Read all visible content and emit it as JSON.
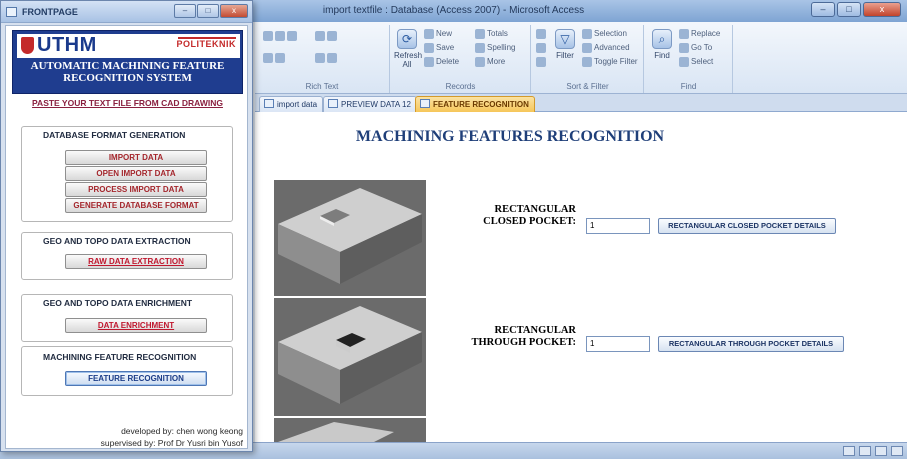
{
  "access_window": {
    "title": "import textfile : Database (Access 2007) - Microsoft Access",
    "window_buttons": [
      "–",
      "□",
      "x"
    ],
    "ribbon": {
      "groups": [
        {
          "label": "Rich Text"
        },
        {
          "label": "Records"
        },
        {
          "label": "Sort & Filter"
        },
        {
          "label": "Find"
        }
      ],
      "refresh_label": "Refresh All",
      "records_items": {
        "new": "New",
        "save": "Save",
        "delete": "Delete",
        "totals": "Totals",
        "spelling": "Spelling",
        "more": "More"
      },
      "filter_items": {
        "filter": "Filter",
        "selection": "Selection",
        "advanced": "Advanced",
        "toggle": "Toggle Filter"
      },
      "find_items": {
        "find": "Find",
        "replace": "Replace",
        "goto": "Go To",
        "select": "Select"
      }
    },
    "doc_tabs": [
      {
        "label": "import data",
        "active": false
      },
      {
        "label": "PREVIEW DATA 12",
        "active": false
      },
      {
        "label": "FEATURE RECOGNITION",
        "active": true
      }
    ],
    "form": {
      "title": "MACHINING FEATURES RECOGNITION",
      "features": [
        {
          "label_line1": "RECTANGULAR",
          "label_line2": "CLOSED POCKET:",
          "value": "1",
          "button": "RECTANGULAR CLOSED POCKET DETAILS"
        },
        {
          "label_line1": "RECTANGULAR",
          "label_line2": "THROUGH POCKET:",
          "value": "1",
          "button": "RECTANGULAR THROUGH POCKET DETAILS"
        }
      ]
    }
  },
  "front_window": {
    "title": "FRONTPAGE",
    "window_buttons": [
      "–",
      "□",
      "x"
    ],
    "logos": {
      "uthm": "UTHM",
      "poli": "POLITEKNIK"
    },
    "system_title_line1": "AUTOMATIC MACHINING FEATURE",
    "system_title_line2": "RECOGNITION SYSTEM",
    "paste_link": "PASTE YOUR TEXT FILE FROM CAD DRAWING",
    "sections": [
      {
        "title": "DATABASE FORMAT GENERATION",
        "buttons": [
          "IMPORT DATA",
          "OPEN IMPORT DATA",
          "PROCESS IMPORT DATA",
          "GENERATE DATABASE FORMAT"
        ]
      },
      {
        "title": "GEO AND TOPO DATA EXTRACTION",
        "buttons": [
          "RAW DATA EXTRACTION"
        ]
      },
      {
        "title": "GEO AND TOPO DATA ENRICHMENT",
        "buttons": [
          "DATA ENRICHMENT"
        ]
      },
      {
        "title": "MACHINING FEATURE RECOGNITION",
        "buttons": [
          "FEATURE RECOGNITION"
        ]
      }
    ],
    "credits_line1": "developed by: chen wong keong",
    "credits_line2": "supervised by: Prof Dr Yusri bin Yusof"
  },
  "colors": {
    "accent": "#1f3d8f",
    "active_tab": "#f6c65a",
    "button_text_red": "#a4262c"
  }
}
